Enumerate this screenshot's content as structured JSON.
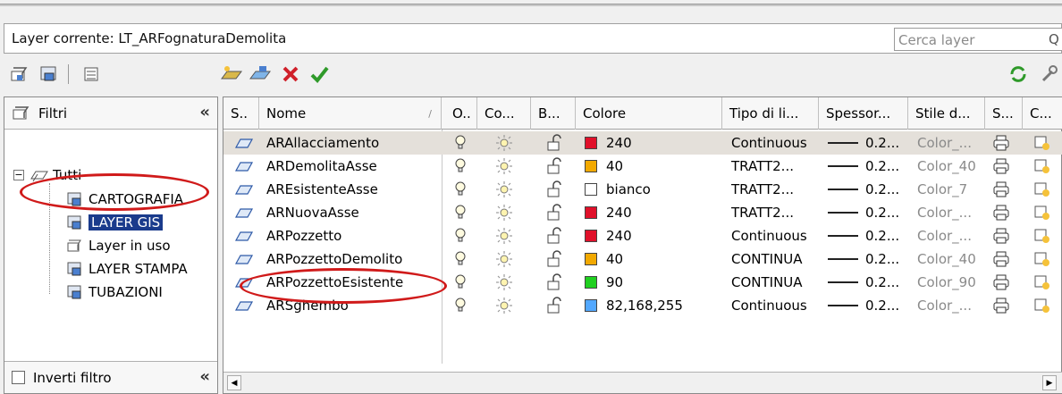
{
  "current_layer": "Layer corrente: LT_ARFognaturaDemolita",
  "search": {
    "placeholder": "Cerca layer"
  },
  "filters": {
    "title": "Filtri",
    "root": "Tutti",
    "items": [
      "CARTOGRAFIA",
      "LAYER GIS",
      "Layer in uso",
      "LAYER STAMPA",
      "TUBAZIONI"
    ],
    "selected": "LAYER GIS",
    "invert_label": "Inverti filtro"
  },
  "columns": [
    "S..",
    "Nome",
    "O..",
    "Co...",
    "B...",
    "Colore",
    "Tipo di li...",
    "Spessor...",
    "Stile d...",
    "S...",
    "C..."
  ],
  "layers": [
    {
      "name": "ARAllacciamento",
      "color_hex": "#e0102a",
      "color": "240",
      "linetype": "Continuous",
      "weight": "0.2...",
      "style": "Color_..."
    },
    {
      "name": "ARDemolitaAsse",
      "color_hex": "#f2a900",
      "color": "40",
      "linetype": "TRATT2...",
      "weight": "0.2...",
      "style": "Color_40"
    },
    {
      "name": "AREsistenteAsse",
      "color_hex": "#ffffff",
      "color": "bianco",
      "linetype": "TRATT2...",
      "weight": "0.2...",
      "style": "Color_7"
    },
    {
      "name": "ARNuovaAsse",
      "color_hex": "#e0102a",
      "color": "240",
      "linetype": "TRATT2...",
      "weight": "0.2...",
      "style": "Color_..."
    },
    {
      "name": "ARPozzetto",
      "color_hex": "#e0102a",
      "color": "240",
      "linetype": "Continuous",
      "weight": "0.2...",
      "style": "Color_..."
    },
    {
      "name": "ARPozzettoDemolito",
      "color_hex": "#f2a900",
      "color": "40",
      "linetype": "CONTINUA",
      "weight": "0.2...",
      "style": "Color_40"
    },
    {
      "name": "ARPozzettoEsistente",
      "color_hex": "#20d020",
      "color": "90",
      "linetype": "CONTINUA",
      "weight": "0.2...",
      "style": "Color_90"
    },
    {
      "name": "ARSghembo",
      "color_hex": "#52a8ff",
      "color": "82,168,255",
      "linetype": "Continuous",
      "weight": "0.2...",
      "style": "Color_..."
    }
  ]
}
